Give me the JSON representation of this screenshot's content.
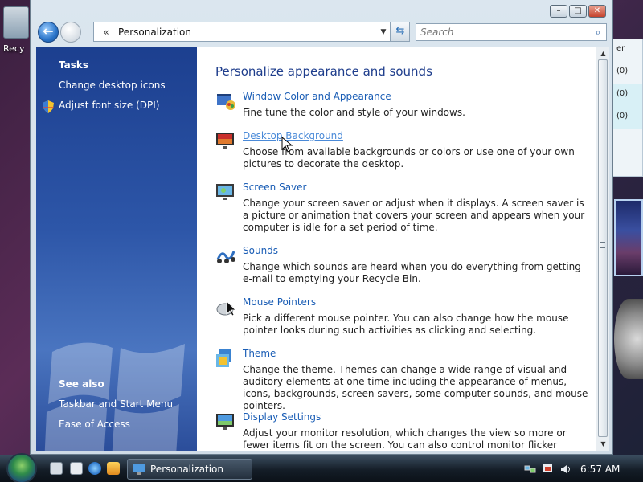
{
  "desktop": {
    "recycle_label": "Recy",
    "gadgets": {
      "header_fragment": "er",
      "rows": [
        "(0)",
        "(0)",
        "(0)"
      ]
    }
  },
  "window": {
    "caption_buttons": {
      "minimize": "–",
      "maximize": "□",
      "close": "✕"
    },
    "address": {
      "chevrons": "«",
      "path": "Personalization"
    },
    "search": {
      "placeholder": "Search"
    }
  },
  "task_pane": {
    "tasks_heading": "Tasks",
    "tasks": [
      {
        "label": "Change desktop icons"
      },
      {
        "label": "Adjust font size (DPI)"
      }
    ],
    "see_also_heading": "See also",
    "see_also": [
      {
        "label": "Taskbar and Start Menu"
      },
      {
        "label": "Ease of Access"
      }
    ]
  },
  "content": {
    "title": "Personalize appearance and sounds",
    "items": [
      {
        "link": "Window Color and Appearance",
        "desc": "Fine tune the color and style of your windows.",
        "icon": "window-color-icon"
      },
      {
        "link": "Desktop Background",
        "desc": "Choose from available backgrounds or colors or use one of your own pictures to decorate the desktop.",
        "icon": "desktop-background-icon"
      },
      {
        "link": "Screen Saver",
        "desc": "Change your screen saver or adjust when it displays. A screen saver is a picture or animation that covers your screen and appears when your computer is idle for a set period of time.",
        "icon": "screen-saver-icon"
      },
      {
        "link": "Sounds",
        "desc": "Change which sounds are heard when you do everything from getting e-mail to emptying your Recycle Bin.",
        "icon": "sounds-icon"
      },
      {
        "link": "Mouse Pointers",
        "desc": "Pick a different mouse pointer. You can also change how the mouse pointer looks during such activities as clicking and selecting.",
        "icon": "mouse-icon"
      },
      {
        "link": "Theme",
        "desc": "Change the theme. Themes can change a wide range of visual and auditory elements at one time including the appearance of menus, icons, backgrounds, screen savers, some computer sounds, and mouse pointers.",
        "icon": "theme-icon"
      },
      {
        "link": "Display Settings",
        "desc": "Adjust your monitor resolution, which changes the view so more or fewer items fit on the screen. You can also control monitor flicker (refresh rate).",
        "icon": "display-icon"
      }
    ]
  },
  "taskbar": {
    "task_label": "Personalization",
    "clock": "6:57 AM"
  }
}
